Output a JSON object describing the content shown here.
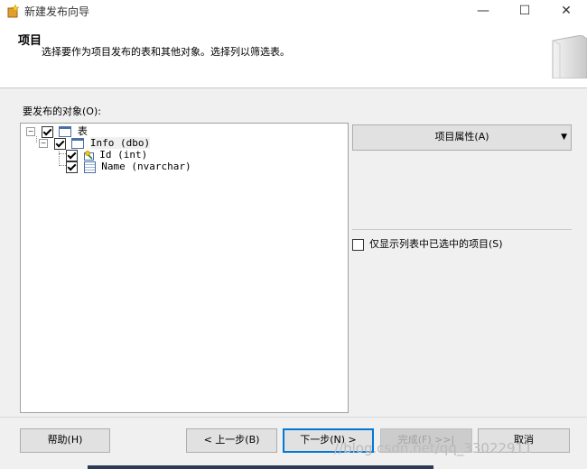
{
  "window": {
    "title": "新建发布向导",
    "minimize_glyph": "—",
    "maximize_glyph": "☐",
    "close_glyph": "✕"
  },
  "header": {
    "title": "项目",
    "description": "选择要作为项目发布的表和其他对象。选择列以筛选表。"
  },
  "objects": {
    "label": "要发布的对象(O):",
    "tree": [
      {
        "label": "表",
        "level": 0,
        "checked": true,
        "expanded": true,
        "icon": "table-icon"
      },
      {
        "label": "Info (dbo)",
        "level": 1,
        "checked": true,
        "expanded": true,
        "icon": "table-icon"
      },
      {
        "label": "Id (int)",
        "level": 2,
        "checked": true,
        "icon": "key-column-icon"
      },
      {
        "label": "Name (nvarchar)",
        "level": 2,
        "checked": true,
        "icon": "column-icon"
      }
    ]
  },
  "side": {
    "properties_button": "项目属性(A)",
    "dropdown_glyph": "▼",
    "only_show_checked": "仅显示列表中已选中的项目(S)",
    "only_show_checked_value": false
  },
  "footer": {
    "help": "帮助(H)",
    "back": "< 上一步(B)",
    "next": "下一步(N) >",
    "finish": "完成(F) >>|",
    "cancel": "取消",
    "watermark": "//blog.csdn.net/qq_33022911"
  },
  "colors": {
    "accent": "#0078d7",
    "content_bg": "#f0f0f0",
    "button_bg": "#e1e1e1"
  }
}
